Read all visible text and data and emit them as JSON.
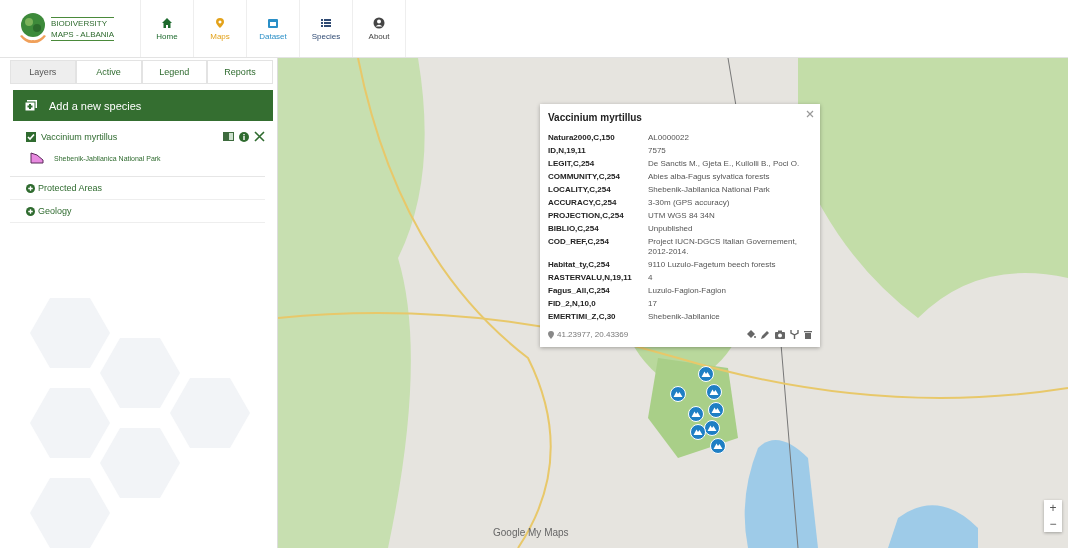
{
  "logo": {
    "line_1": "BIODIVERSITY",
    "line_2": "MAPS - ALBANIA"
  },
  "nav": [
    {
      "label": "Home"
    },
    {
      "label": "Maps"
    },
    {
      "label": "Dataset"
    },
    {
      "label": "Species"
    },
    {
      "label": "About"
    }
  ],
  "tabs": [
    {
      "label": "Layers",
      "selected": true
    },
    {
      "label": "Active",
      "selected": false
    },
    {
      "label": "Legend",
      "selected": false
    },
    {
      "label": "Reports",
      "selected": false
    }
  ],
  "add_button": "Add a new species",
  "layer": {
    "name": "Vaccinium myrtillus",
    "checked": true,
    "legend": [
      {
        "label": "Shebenik-Jabllanica National Park",
        "color": "#e88ae0"
      }
    ]
  },
  "groups": [
    {
      "label": "Protected Areas"
    },
    {
      "label": "Geology"
    }
  ],
  "popup": {
    "title": "Vaccinium myrtillus",
    "rows": [
      {
        "key": "Natura2000,C,150",
        "value": "AL0000022"
      },
      {
        "key": "ID,N,19,11",
        "value": "7575"
      },
      {
        "key": "LEGIT,C,254",
        "value": "De Sanctis M., Gjeta E., Kullolli B., Poci O."
      },
      {
        "key": "COMMUNITY,C,254",
        "value": "Abies alba-Fagus sylvatica forests"
      },
      {
        "key": "LOCALITY,C,254",
        "value": "Shebenik-Jabllanica National Park"
      },
      {
        "key": "ACCURACY,C,254",
        "value": "3-30m (GPS accuracy)"
      },
      {
        "key": "PROJECTION,C,254",
        "value": "UTM WGS 84 34N"
      },
      {
        "key": "BIBLIO,C,254",
        "value": "Unpublished"
      },
      {
        "key": "COD_REF,C,254",
        "value": "Project IUCN-DGCS Italian Governement, 2012-2014."
      },
      {
        "key": "Habitat_ty,C,254",
        "value": "9110 Luzulo-Fagetum beech forests"
      },
      {
        "key": "RASTERVALU,N,19,11",
        "value": "4"
      },
      {
        "key": "Fagus_All,C,254",
        "value": "Luzulo-Fagion-Fagion"
      },
      {
        "key": "FID_2,N,10,0",
        "value": "17"
      },
      {
        "key": "EMERTIMI_Z,C,30",
        "value": "Shebenik-Jabllanice"
      }
    ],
    "coords": "41.23977, 20.43369"
  },
  "map_brand": "Google My Maps",
  "zoom": {
    "plus": "+",
    "minus": "−"
  }
}
